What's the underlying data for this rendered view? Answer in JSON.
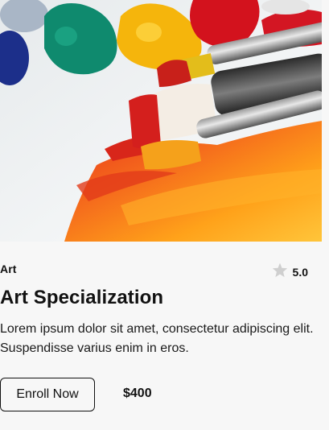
{
  "course": {
    "image_alt": "Paint tubes and brushes with orange paint",
    "category": "Art",
    "rating": "5.0",
    "title": "Art Specialization",
    "description": "Lorem ipsum dolor sit amet, consectetur adipiscing elit. Suspendisse varius enim in eros.",
    "enroll_label": "Enroll Now",
    "price": "$400"
  },
  "icons": {
    "rating": "star-icon"
  },
  "colors": {
    "background": "#f7f7f7",
    "text": "#111111",
    "star": "#cfcfcf",
    "button_border": "#111111"
  }
}
